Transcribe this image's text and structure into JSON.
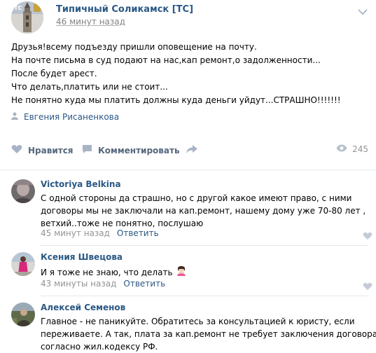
{
  "post": {
    "group_name": "Типичный Соликамск [ТС]",
    "time": "46 минут назад",
    "text_lines": [
      "Друзья!всему подъезду пришли оповещение на почту.",
      "На почте письма в суд подают на нас,кап ремонт,о задолженности...",
      "После будет арест.",
      "Что делать,платить или не стоит...",
      "Не понятно куда мы платить должны куда деньги уйдут...СТРАШНО!!!!!!!"
    ],
    "signer": "Евгения Рисаненкова",
    "actions": {
      "like_label": "Нравится",
      "comment_label": "Комментировать",
      "views": "245"
    }
  },
  "comments": [
    {
      "author": "Victoriya Belkina",
      "text_lines": [
        "С одной стороны да страшно, но с другой какое имеют право, с ними",
        "договоры мы не заключали на кап.ремонт, нашему дому уже 70-80 лет ,",
        "ветхий..тоже не понятно, послушаю"
      ],
      "time": "45 минут назад",
      "reply_label": "Ответить"
    },
    {
      "author": "Ксения Швецова",
      "text_lines": [
        "И я тоже не знаю, что делать"
      ],
      "time": "43 минуты назад",
      "reply_label": "Ответить"
    },
    {
      "author": "Алексей Семенов",
      "text_lines": [
        "Главное - не паникуйте. Обратитесь за консультацией к юристу, если",
        "переживаете. А так, плата за кап.ремонт не требует заключения договора,",
        "согласно жил.кодексу РФ."
      ]
    }
  ],
  "colors": {
    "link": "#2a5885",
    "muted": "#828282",
    "action": "#55677d",
    "divider": "#e7e8ec"
  },
  "icons": [
    "more-icon",
    "signer-icon",
    "heart-icon",
    "comment-icon",
    "share-icon",
    "eye-icon"
  ]
}
